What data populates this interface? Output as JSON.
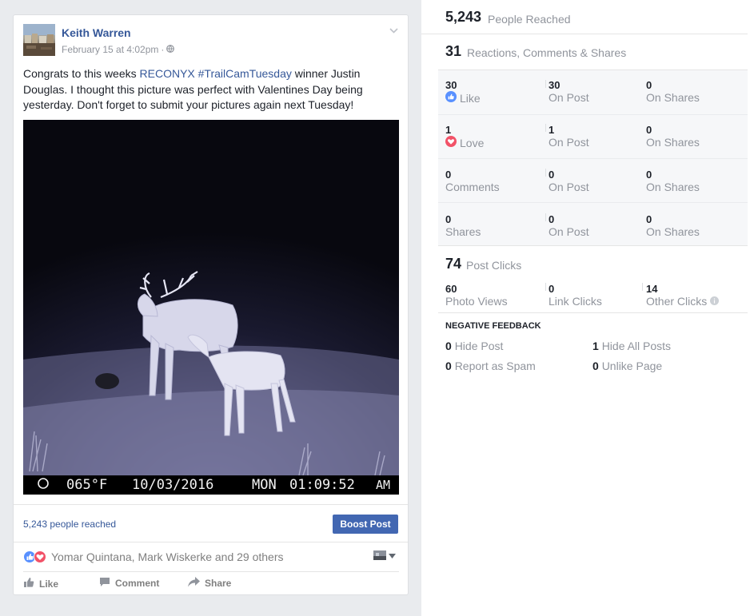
{
  "post": {
    "author": "Keith Warren",
    "timestamp": "February 15 at 4:02pm",
    "privacy_icon": "globe-icon",
    "text_before": "Congrats to this weeks ",
    "link_brand": "RECONYX",
    "link_hashtag": "#TrailCamTuesday",
    "text_after": " winner Justin Douglas. I thought this picture was perfect with Valentines Day being yesterday. Don't forget to submit your pictures again next Tuesday!",
    "photo_stamp": {
      "temperature": "065°F",
      "date": "10/03/2016",
      "day": "MON",
      "time": "01:09:52",
      "ampm": "AM"
    },
    "reach_text": "5,243 people reached",
    "boost_label": "Boost Post",
    "reaction_names": "Yomar Quintana, Mark Wiskerke and 29 others",
    "actions": {
      "like": "Like",
      "comment": "Comment",
      "share": "Share"
    }
  },
  "insights": {
    "people_reached": {
      "value": "5,243",
      "label": "People Reached"
    },
    "engagement": {
      "value": "31",
      "label": "Reactions, Comments & Shares"
    },
    "breakdown": [
      {
        "total": "30",
        "label": "Like",
        "icon": "like-icon",
        "on_post": "30",
        "on_post_label": "On Post",
        "on_shares": "0",
        "on_shares_label": "On Shares"
      },
      {
        "total": "1",
        "label": "Love",
        "icon": "love-icon",
        "on_post": "1",
        "on_post_label": "On Post",
        "on_shares": "0",
        "on_shares_label": "On Shares"
      },
      {
        "total": "0",
        "label": "Comments",
        "on_post": "0",
        "on_post_label": "On Post",
        "on_shares": "0",
        "on_shares_label": "On Shares"
      },
      {
        "total": "0",
        "label": "Shares",
        "on_post": "0",
        "on_post_label": "On Post",
        "on_shares": "0",
        "on_shares_label": "On Shares"
      }
    ],
    "post_clicks": {
      "value": "74",
      "label": "Post Clicks"
    },
    "click_breakdown": [
      {
        "value": "60",
        "label": "Photo Views"
      },
      {
        "value": "0",
        "label": "Link Clicks"
      },
      {
        "value": "14",
        "label": "Other Clicks"
      }
    ],
    "negative_feedback": {
      "title": "NEGATIVE FEEDBACK",
      "items": [
        {
          "value": "0",
          "label": "Hide Post"
        },
        {
          "value": "1",
          "label": "Hide All Posts"
        },
        {
          "value": "0",
          "label": "Report as Spam"
        },
        {
          "value": "0",
          "label": "Unlike Page"
        }
      ]
    }
  },
  "colors": {
    "link": "#365899",
    "boost": "#4267b2",
    "like_blue": "#5890ff",
    "love_red": "#f25268"
  }
}
